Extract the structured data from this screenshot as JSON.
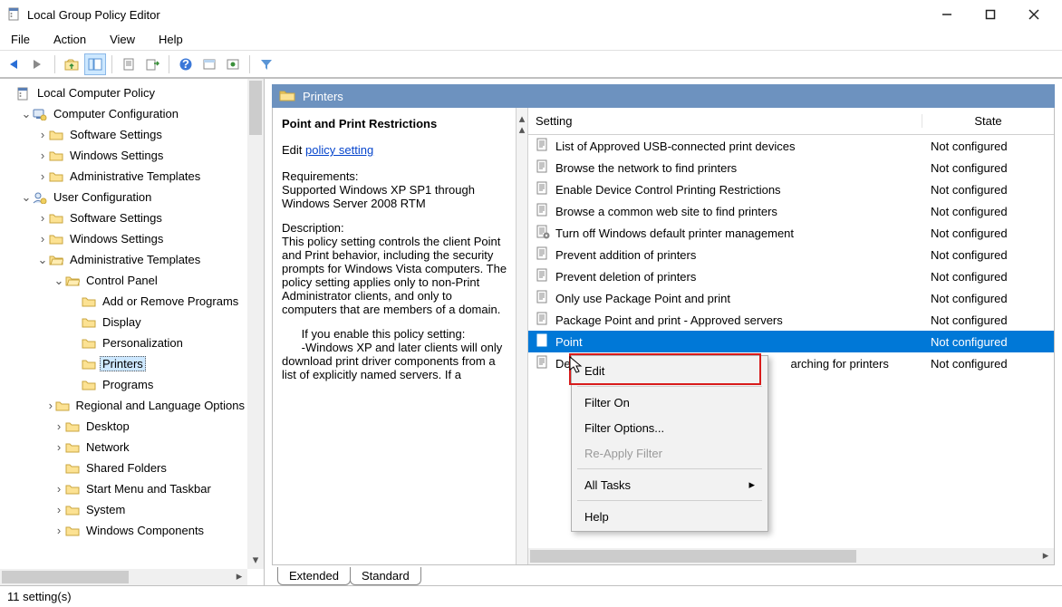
{
  "window": {
    "title": "Local Group Policy Editor"
  },
  "menu": {
    "file": "File",
    "action": "Action",
    "view": "View",
    "help": "Help"
  },
  "tree": {
    "root": "Local Computer Policy",
    "cc": "Computer Configuration",
    "uc": "User Configuration",
    "ss": "Software Settings",
    "ws": "Windows Settings",
    "at": "Administrative Templates",
    "cp": "Control Panel",
    "arp": "Add or Remove Programs",
    "display": "Display",
    "pers": "Personalization",
    "printers": "Printers",
    "programs": "Programs",
    "regional": "Regional and Language Options",
    "desktop": "Desktop",
    "network": "Network",
    "shared": "Shared Folders",
    "startmenu": "Start Menu and Taskbar",
    "system": "System",
    "wincomp": "Windows Components"
  },
  "header": {
    "folder": "Printers"
  },
  "desc": {
    "title": "Point and Print Restrictions",
    "edit": "Edit",
    "link": "policy setting",
    "req_label": "Requirements:",
    "req_text": "Supported Windows XP SP1 through Windows Server 2008 RTM",
    "desc_label": "Description:",
    "body1": "This policy setting controls the client Point and Print behavior, including the security prompts for Windows Vista computers. The policy setting applies only to non-Print Administrator clients, and only to computers that are members of a domain.",
    "body2": "      If you enable this policy setting:",
    "body3": "      -Windows XP and later clients will only download print driver components from a list of explicitly named servers. If a"
  },
  "columns": {
    "setting": "Setting",
    "state": "State"
  },
  "settings": [
    {
      "name": "List of Approved USB-connected print devices",
      "state": "Not configured"
    },
    {
      "name": "Browse the network to find printers",
      "state": "Not configured"
    },
    {
      "name": "Enable Device Control Printing Restrictions",
      "state": "Not configured"
    },
    {
      "name": "Browse a common web site to find printers",
      "state": "Not configured"
    },
    {
      "name": "Turn off Windows default printer management",
      "state": "Not configured",
      "icon": "gear"
    },
    {
      "name": "Prevent addition of printers",
      "state": "Not configured"
    },
    {
      "name": "Prevent deletion of printers",
      "state": "Not configured"
    },
    {
      "name": "Only use Package Point and print",
      "state": "Not configured"
    },
    {
      "name": "Package Point and print - Approved servers",
      "state": "Not configured"
    },
    {
      "name": "Point",
      "state": "Not configured",
      "selected": true
    },
    {
      "name": "Default Active Directory path when searching for printers",
      "state": "Not configured",
      "trunc": "Defa"
    }
  ],
  "tabs": {
    "extended": "Extended",
    "standard": "Standard"
  },
  "status": {
    "text": "11 setting(s)"
  },
  "context": {
    "edit": "Edit",
    "filter_on": "Filter On",
    "filter_options": "Filter Options...",
    "reapply": "Re-Apply Filter",
    "all_tasks": "All Tasks",
    "help": "Help"
  }
}
